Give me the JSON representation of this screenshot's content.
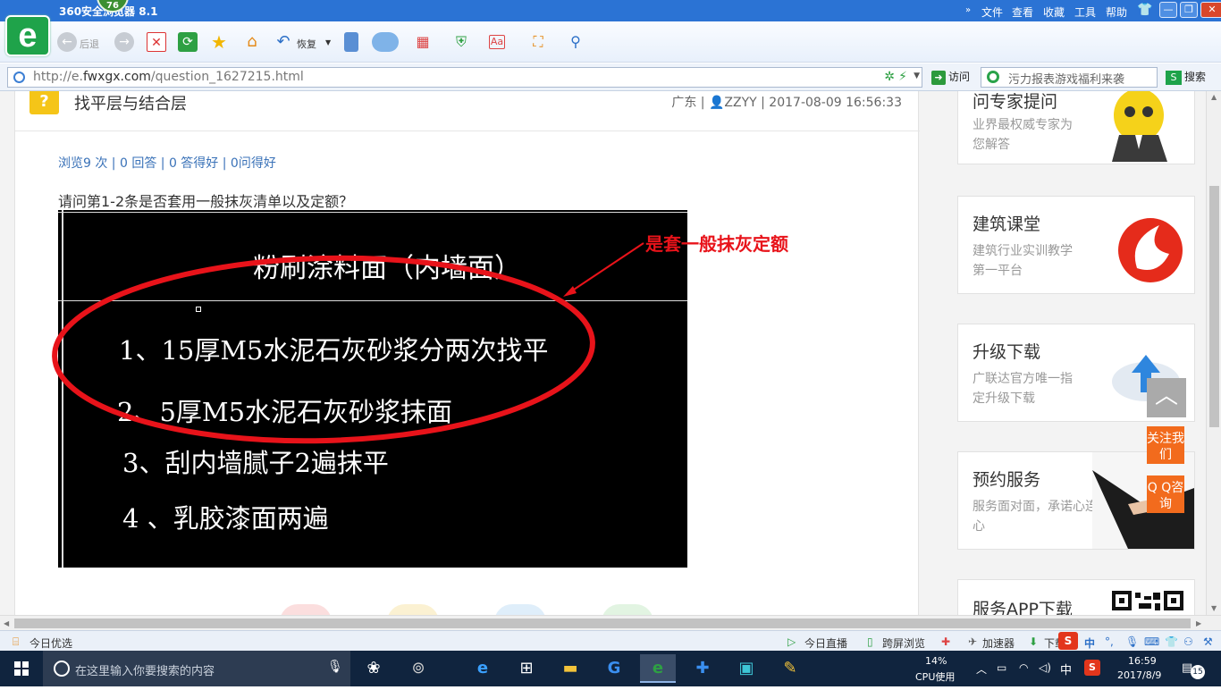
{
  "browser": {
    "title": "360安全浏览器 8.1",
    "badge": "76",
    "menus": [
      "文件",
      "查看",
      "收藏",
      "工具",
      "帮助"
    ],
    "toolbar": {
      "back": "后退",
      "restore": "恢复"
    },
    "url_prefix": "http://e.",
    "url_domain": "fwxgx.com",
    "url_path": "/question_1627215.html",
    "go_label": "访问",
    "search_placeholder": "污力报表游戏福利来袭",
    "search_button": "搜索"
  },
  "question": {
    "title": "找平层与结合层",
    "meta": "广东 | 👤ZZYY | 2017-08-09 16:56:33",
    "stats": "浏览9 次 | 0 回答 | 0 答得好 | 0问得好",
    "text": "请问第1-2条是否套用一般抹灰清单以及定额？",
    "image": {
      "heading": "粉刷涂料面（内墙面）",
      "lines": [
        "1、15厚M5水泥石灰砂浆分两次找平",
        "2、5厚M5水泥石灰砂浆抹面",
        "3、刮内墙腻子2遍抹平",
        "4 、乳胶漆面两遍"
      ]
    },
    "annotation": "是套一般抹灰定额"
  },
  "sidebar": [
    {
      "heading": "问专家提问",
      "sub": "业界最权威专家为您解答"
    },
    {
      "heading": "建筑课堂",
      "sub": "建筑行业实训教学第一平台"
    },
    {
      "heading": "升级下载",
      "sub": "广联达官方唯一指定升级下载"
    },
    {
      "heading": "预约服务",
      "sub": "服务面对面，承诺心连心"
    },
    {
      "heading": "服务APP下载",
      "sub": ""
    }
  ],
  "floating": {
    "follow": "关注我们",
    "qq": "Q Q咨询"
  },
  "statusbar": {
    "left": "今日优选",
    "live": "今日直播",
    "crossscreen": "跨屏浏览",
    "accelerator": "加速器",
    "download": "下载"
  },
  "taskbar": {
    "search_placeholder": "在这里输入你要搜索的内容",
    "cpu_percent": "14%",
    "cpu_label": "CPU使用",
    "ime": "中",
    "time": "16:59",
    "date": "2017/8/9",
    "notifications": "15"
  },
  "colors": {
    "accent": "#2b73d4",
    "annotation": "#e8131a",
    "link": "#3a72b8",
    "orange": "#f26b1d"
  }
}
